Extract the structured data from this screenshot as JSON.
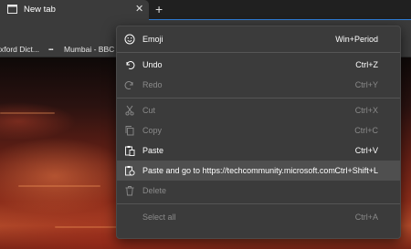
{
  "browser": {
    "tab": {
      "title": "New tab",
      "close_glyph": "✕",
      "icon": "new-tab-page-icon"
    },
    "newtab_glyph": "+",
    "accent_color": "#2f7fd9"
  },
  "favorites": [
    {
      "label": "xford Dict..."
    },
    {
      "label": "Mumbai - BBC V",
      "icon_text": "BBC"
    }
  ],
  "context_menu": {
    "items": [
      {
        "label": "Emoji",
        "shortcut": "Win+Period",
        "icon": "emoji-icon",
        "enabled": true
      },
      {
        "label": "Undo",
        "shortcut": "Ctrl+Z",
        "icon": "undo-icon",
        "enabled": true
      },
      {
        "label": "Redo",
        "shortcut": "Ctrl+Y",
        "icon": "redo-icon",
        "enabled": false
      },
      {
        "label": "Cut",
        "shortcut": "Ctrl+X",
        "icon": "cut-icon",
        "enabled": false
      },
      {
        "label": "Copy",
        "shortcut": "Ctrl+C",
        "icon": "copy-icon",
        "enabled": false
      },
      {
        "label": "Paste",
        "shortcut": "Ctrl+V",
        "icon": "paste-icon",
        "enabled": true
      },
      {
        "label": "Paste and go to https://techcommunity.microsoft.com",
        "shortcut": "Ctrl+Shift+L",
        "icon": "paste-and-go-icon",
        "enabled": true,
        "highlighted": true
      },
      {
        "label": "Delete",
        "shortcut": "",
        "icon": "delete-icon",
        "enabled": false
      },
      {
        "label": "Select all",
        "shortcut": "Ctrl+A",
        "icon": "",
        "enabled": false
      }
    ]
  },
  "colors": {
    "menu_bg": "#3b3b3b",
    "menu_highlight": "#4f4f4f",
    "disabled_text": "#8a8a8a"
  }
}
